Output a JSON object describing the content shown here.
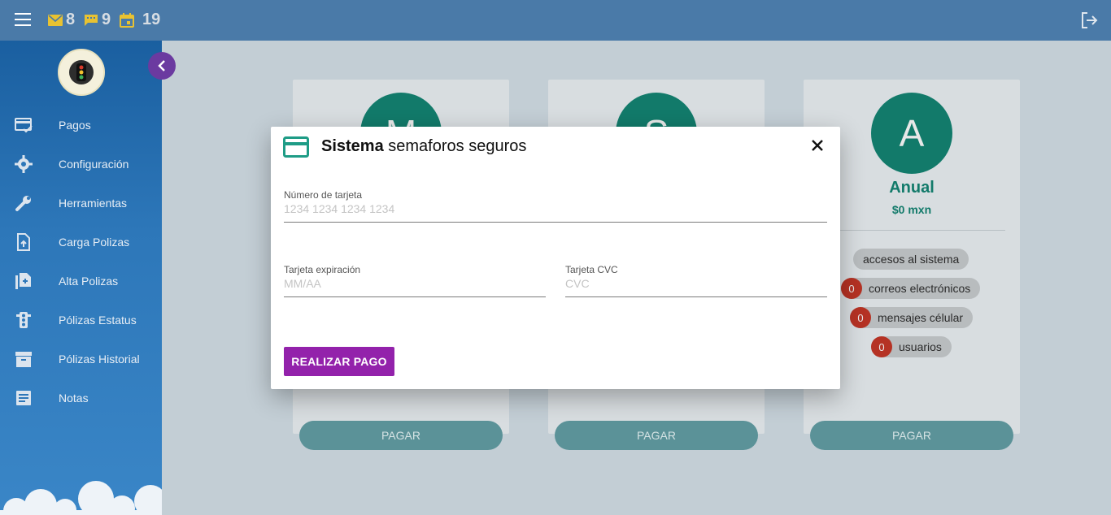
{
  "topbar": {
    "mail_count": "8",
    "messages_count": "9",
    "calendar_count": "19"
  },
  "sidebar": {
    "items": [
      {
        "label": "Pagos",
        "icon": "payment-check-icon"
      },
      {
        "label": "Configuración",
        "icon": "gear-icon"
      },
      {
        "label": "Herramientas",
        "icon": "wrench-icon"
      },
      {
        "label": "Carga Polizas",
        "icon": "file-upload-icon"
      },
      {
        "label": "Alta Polizas",
        "icon": "add-document-icon"
      },
      {
        "label": "Pólizas Estatus",
        "icon": "traffic-light-icon"
      },
      {
        "label": "Pólizas Historial",
        "icon": "archive-icon"
      },
      {
        "label": "Notas",
        "icon": "notes-icon"
      }
    ]
  },
  "plans": [
    {
      "initial": "M",
      "pay_label": "PAGAR"
    },
    {
      "initial": "S",
      "pay_label": "PAGAR"
    },
    {
      "initial": "A",
      "name": "Anual",
      "price": "$0 mxn",
      "features": [
        {
          "count": "",
          "label": "accesos al sistema"
        },
        {
          "count": "0",
          "label": "correos electrónicos"
        },
        {
          "count": "0",
          "label": "mensajes célular"
        },
        {
          "count": "0",
          "label": "usuarios"
        }
      ],
      "pay_label": "PAGAR"
    }
  ],
  "modal": {
    "title_bold": "Sistema",
    "title_rest": " semaforos seguros",
    "card_number": {
      "label": "Número de tarjeta",
      "placeholder": "1234 1234 1234 1234",
      "value": ""
    },
    "expiration": {
      "label": "Tarjeta expiración",
      "placeholder": "MM/AA",
      "value": ""
    },
    "cvc": {
      "label": "Tarjeta CVC",
      "placeholder": "CVC",
      "value": ""
    },
    "submit_label": "REALIZAR PAGO"
  },
  "colors": {
    "topbar": "#4a7aa8",
    "accent_purple": "#9322ab",
    "teal": "#127a6a",
    "badge_red": "#b53224"
  }
}
